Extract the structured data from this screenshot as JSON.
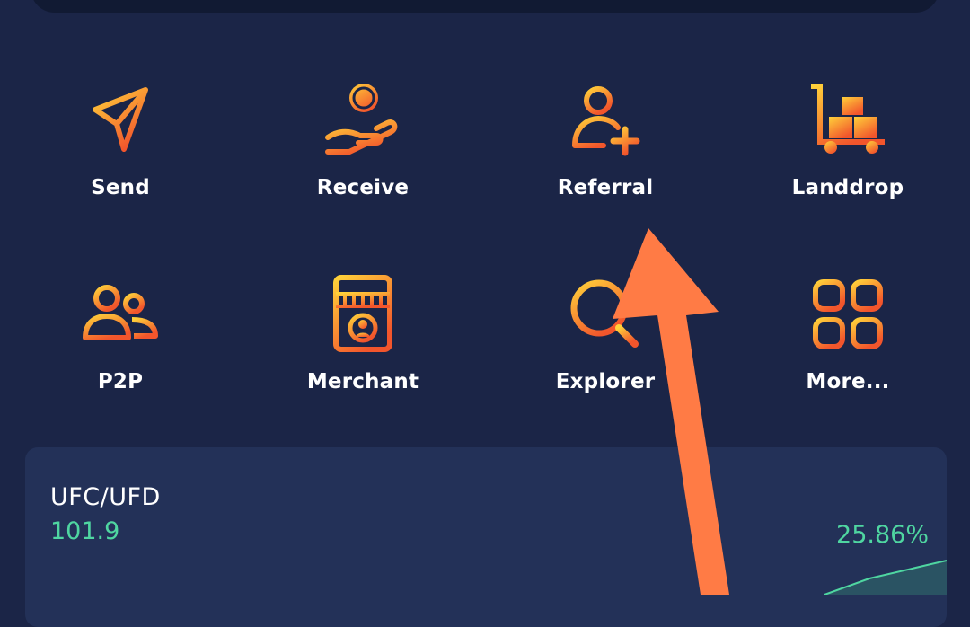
{
  "actions": [
    {
      "label": "Send",
      "icon": "send-icon"
    },
    {
      "label": "Receive",
      "icon": "receive-coin-icon"
    },
    {
      "label": "Referral",
      "icon": "add-user-icon"
    },
    {
      "label": "Landdrop",
      "icon": "cart-boxes-icon"
    },
    {
      "label": "P2P",
      "icon": "users-icon"
    },
    {
      "label": "Merchant",
      "icon": "store-icon"
    },
    {
      "label": "Explorer",
      "icon": "search-icon"
    },
    {
      "label": "More...",
      "icon": "grid-icon"
    }
  ],
  "ticker": {
    "pair": "UFC/UFD",
    "price": "101.9",
    "change": "25.86%"
  },
  "colors": {
    "background": "#1b2547",
    "card": "#233158",
    "accent_green": "#4fd6a1",
    "icon_gradient_start": "#ffd23a",
    "icon_gradient_end": "#f2552c",
    "annotation_arrow": "#ff7b45"
  }
}
